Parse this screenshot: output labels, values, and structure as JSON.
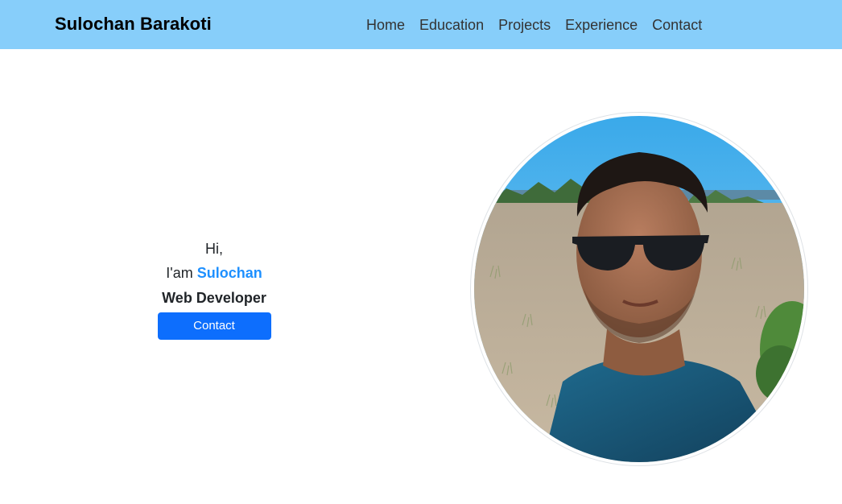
{
  "header": {
    "brand": "Sulochan Barakoti",
    "nav": [
      {
        "label": "Home"
      },
      {
        "label": "Education"
      },
      {
        "label": "Projects"
      },
      {
        "label": "Experience"
      },
      {
        "label": "Contact"
      }
    ]
  },
  "hero": {
    "greeting": "Hi,",
    "iam_prefix": "I'am",
    "name": "Sulochan",
    "role": "Web Developer",
    "cta_label": "Contact"
  },
  "colors": {
    "navbar_bg": "#87cefa",
    "accent_name": "#1e90ff",
    "button_bg": "#0d6efd"
  }
}
